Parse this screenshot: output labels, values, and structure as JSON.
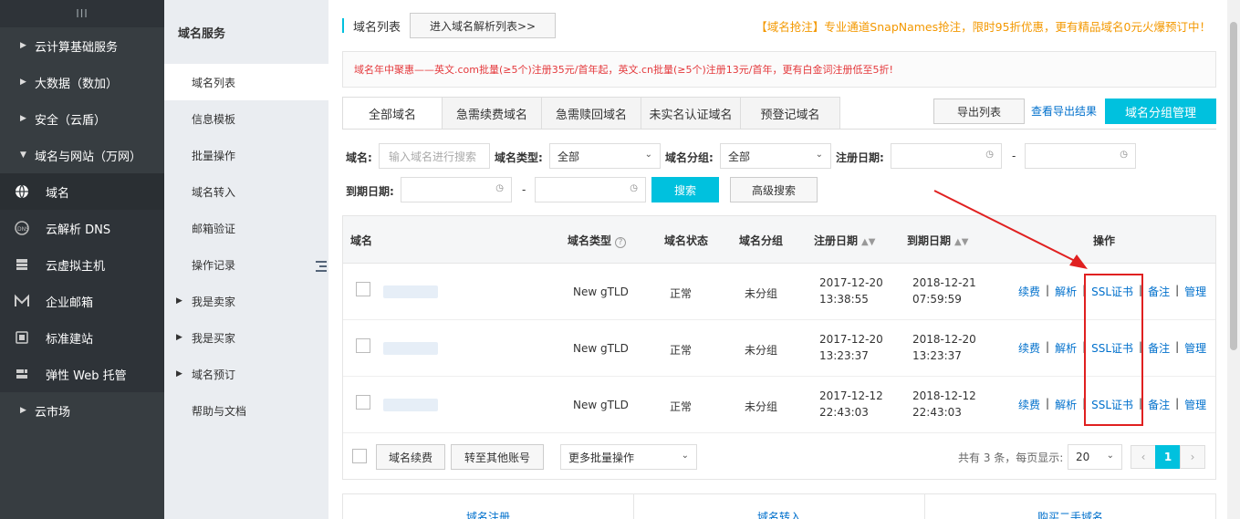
{
  "sidebar": {
    "top_icon": "III",
    "items": [
      {
        "label": "云计算基础服务",
        "kind": "group",
        "caret": "▶"
      },
      {
        "label": "大数据（数加）",
        "kind": "group",
        "caret": "▶"
      },
      {
        "label": "安全（云盾）",
        "kind": "group",
        "caret": "▶"
      },
      {
        "label": "域名与网站（万网）",
        "kind": "group-open",
        "caret": "▼"
      },
      {
        "label": "域名",
        "kind": "sub",
        "icon": "globe-icon",
        "active": true
      },
      {
        "label": "云解析 DNS",
        "kind": "sub",
        "icon": "dns-icon"
      },
      {
        "label": "云虚拟主机",
        "kind": "sub",
        "icon": "server-icon"
      },
      {
        "label": "企业邮箱",
        "kind": "sub",
        "icon": "mail-icon"
      },
      {
        "label": "标准建站",
        "kind": "sub",
        "icon": "site-icon"
      },
      {
        "label": "弹性 Web 托管",
        "kind": "sub",
        "icon": "hosting-icon"
      },
      {
        "label": "云市场",
        "kind": "group",
        "caret": "▶"
      }
    ]
  },
  "submenu": {
    "title": "域名服务",
    "items": [
      {
        "label": "域名列表",
        "active": true
      },
      {
        "label": "信息模板"
      },
      {
        "label": "批量操作"
      },
      {
        "label": "域名转入"
      },
      {
        "label": "邮箱验证"
      },
      {
        "label": "操作记录"
      },
      {
        "label": "我是卖家",
        "caret": "▶"
      },
      {
        "label": "我是买家",
        "caret": "▶"
      },
      {
        "label": "域名预订",
        "caret": "▶"
      },
      {
        "label": "帮助与文档"
      }
    ]
  },
  "header": {
    "title": "域名列表",
    "dns_button": "进入域名解析列表>>",
    "promo": "【域名抢注】专业通道SnapNames抢注，限时95折优惠，更有精品域名0元火爆预订中！"
  },
  "notice": "域名年中聚惠——英文.com批量(≥5个)注册35元/首年起，英文.cn批量(≥5个)注册13元/首年，更有白金词注册低至5折!",
  "tabs": [
    "全部域名",
    "急需续费域名",
    "急需赎回域名",
    "未实名认证域名",
    "预登记域名"
  ],
  "actions": {
    "export": "导出列表",
    "export_result": "查看导出结果",
    "group_manage": "域名分组管理"
  },
  "filters": {
    "domain_label": "域名:",
    "domain_placeholder": "输入域名进行搜索",
    "type_label": "域名类型:",
    "type_value": "全部",
    "group_label": "域名分组:",
    "group_value": "全部",
    "reg_label": "注册日期:",
    "exp_label": "到期日期:",
    "dash": "-",
    "search": "搜索",
    "advanced": "高级搜索"
  },
  "table": {
    "headers": {
      "domain": "域名",
      "type": "域名类型",
      "status": "域名状态",
      "group": "域名分组",
      "reg": "注册日期",
      "exp": "到期日期",
      "ops": "操作"
    },
    "rows": [
      {
        "type": "New gTLD",
        "status": "正常",
        "group": "未分组",
        "reg_date": "2017-12-20",
        "reg_time": "13:38:55",
        "exp_date": "2018-12-21",
        "exp_time": "07:59:59"
      },
      {
        "type": "New gTLD",
        "status": "正常",
        "group": "未分组",
        "reg_date": "2017-12-20",
        "reg_time": "13:23:37",
        "exp_date": "2018-12-20",
        "exp_time": "13:23:37"
      },
      {
        "type": "New gTLD",
        "status": "正常",
        "group": "未分组",
        "reg_date": "2017-12-12",
        "reg_time": "22:43:03",
        "exp_date": "2018-12-12",
        "exp_time": "22:43:03"
      }
    ],
    "op_links": [
      "续费",
      "解析",
      "SSL证书",
      "备注",
      "管理"
    ],
    "op_sep": "|"
  },
  "footer": {
    "renew": "域名续费",
    "transfer": "转至其他账号",
    "more_batch": "更多批量操作",
    "total_text": "共有 3 条，每页显示:",
    "page_size": "20",
    "prev": "‹",
    "page": "1",
    "next": "›"
  },
  "bottom_cards": [
    "域名注册",
    "域名转入",
    "购买二手域名"
  ],
  "colors": {
    "accent": "#00c1de",
    "link": "#0070cc",
    "promo": "#f39800",
    "notice": "#e4393c",
    "annotation": "#e02020",
    "sidebar": "#373d41"
  }
}
